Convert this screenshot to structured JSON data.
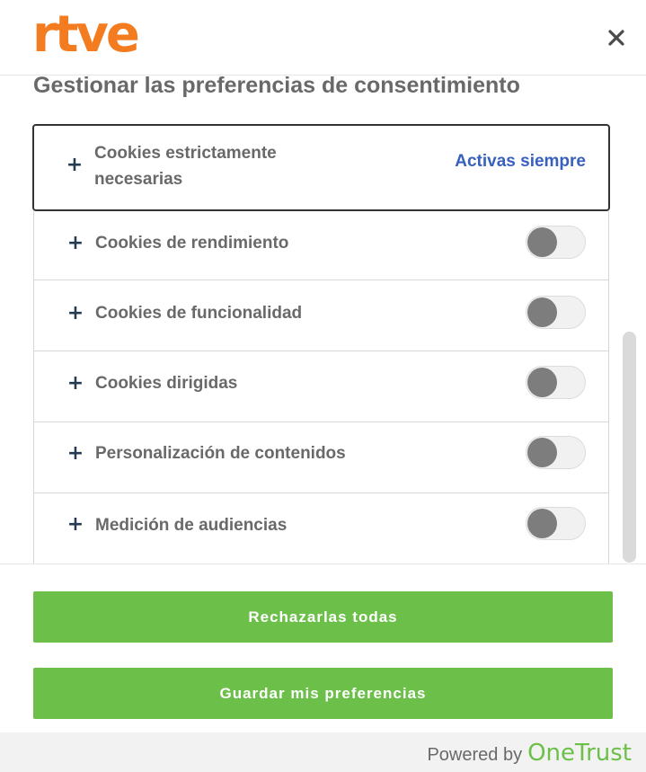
{
  "brand": {
    "logo_text": "rtve",
    "logo_color": "#f37b20"
  },
  "header": {
    "close_icon": "close-icon"
  },
  "panel": {
    "title": "Gestionar las preferencias de consentimiento"
  },
  "categories": [
    {
      "label_line1": "Cookies estrictamente",
      "label_line2": "necesarias",
      "status": "Activas siempre",
      "status_color": "#3860be"
    },
    {
      "label": "Cookies de rendimiento",
      "enabled": false
    },
    {
      "label": "Cookies de funcionalidad",
      "enabled": false
    },
    {
      "label": "Cookies dirigidas",
      "enabled": false
    },
    {
      "label": "Personalización de contenidos",
      "enabled": false
    },
    {
      "label": "Medición de audiencias",
      "enabled": false
    }
  ],
  "actions": {
    "reject_all_label": "Rechazarlas todas",
    "save_label": "Guardar mis preferencias",
    "button_color": "#6cc04a"
  },
  "footer": {
    "powered_by": "Powered by",
    "provider": "OneTrust"
  }
}
